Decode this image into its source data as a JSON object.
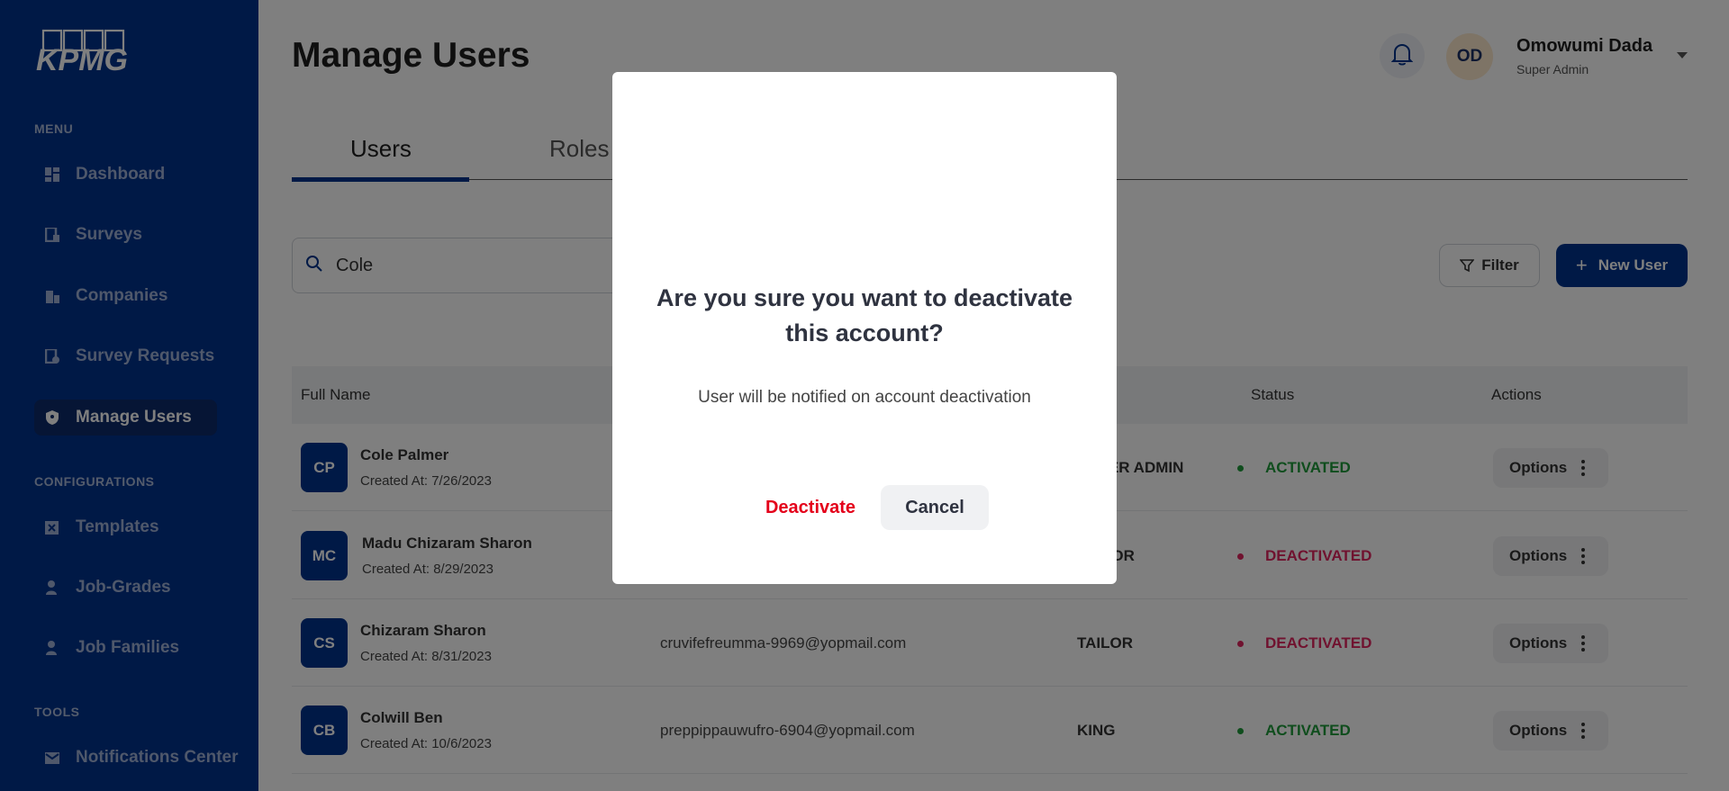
{
  "brand": {
    "logo_text": "KPMG"
  },
  "sidebar": {
    "sections": [
      {
        "label": "MENU"
      },
      {
        "label": "CONFIGURATIONS"
      },
      {
        "label": "TOOLS"
      }
    ],
    "items": [
      {
        "label": "Dashboard",
        "icon": "dashboard-icon"
      },
      {
        "label": "Surveys",
        "icon": "surveys-icon"
      },
      {
        "label": "Companies",
        "icon": "companies-icon"
      },
      {
        "label": "Survey Requests",
        "icon": "survey-requests-icon"
      },
      {
        "label": "Manage Users",
        "icon": "shield-icon",
        "active": true
      },
      {
        "label": "Templates",
        "icon": "templates-icon"
      },
      {
        "label": "Job-Grades",
        "icon": "person-icon"
      },
      {
        "label": "Job Families",
        "icon": "person-icon"
      },
      {
        "label": "Notifications Center",
        "icon": "mail-icon"
      }
    ]
  },
  "header": {
    "title": "Manage Users",
    "user": {
      "initials": "OD",
      "name": "Omowumi Dada",
      "role": "Super Admin"
    }
  },
  "tabs": [
    {
      "label": "Users",
      "active": true
    },
    {
      "label": "Roles",
      "active": false
    }
  ],
  "search": {
    "value": "Cole",
    "placeholder": "Search"
  },
  "toolbar": {
    "filter_label": "Filter",
    "new_user_label": "New User"
  },
  "table": {
    "columns": [
      "Full Name",
      "Status",
      "Actions"
    ],
    "rows": [
      {
        "initials": "CP",
        "name": "Cole Palmer",
        "created": "Created At: 7/26/2023",
        "email": "",
        "role": "SUPER ADMIN",
        "status": "ACTIVATED",
        "action": "Options"
      },
      {
        "initials": "MC",
        "name": "Madu Chizaram Sharon",
        "created": "Created At: 8/29/2023",
        "email": "",
        "role": "EDITOR",
        "status": "DEACTIVATED",
        "action": "Options"
      },
      {
        "initials": "CS",
        "name": "Chizaram Sharon",
        "created": "Created At: 8/31/2023",
        "email": "cruvifefreumma-9969@yopmail.com",
        "role": "TAILOR",
        "status": "DEACTIVATED",
        "action": "Options"
      },
      {
        "initials": "CB",
        "name": "Colwill Ben",
        "created": "Created At: 10/6/2023",
        "email": "preppippauwufro-6904@yopmail.com",
        "role": "KING",
        "status": "ACTIVATED",
        "action": "Options"
      }
    ]
  },
  "modal": {
    "title": "Are you sure you want to deactivate this account?",
    "subtitle": "User will be notified on account deactivation",
    "confirm_label": "Deactivate",
    "cancel_label": "Cancel"
  },
  "colors": {
    "brand": "#00338d",
    "activated": "#1e9b3a",
    "deactivated": "#e0245e",
    "danger": "#e4001a"
  }
}
